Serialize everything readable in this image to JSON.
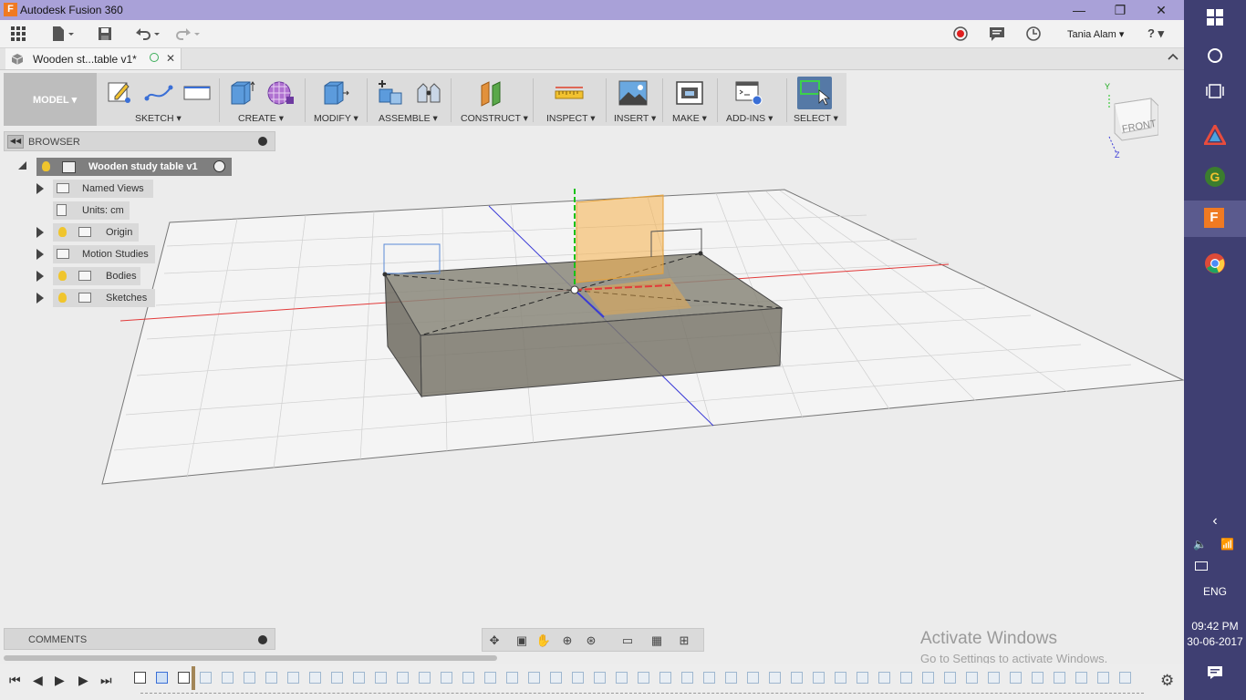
{
  "window": {
    "title": "Autodesk Fusion 360",
    "app_icon_letter": "F",
    "minimize": "—",
    "maximize": "❐",
    "close": "✕"
  },
  "quickbar": {
    "user_name": "Tania Alam ▾",
    "help": "? ▾"
  },
  "document_tab": {
    "label": "Wooden st...table v1*",
    "close": "✕"
  },
  "workspace": {
    "label": "MODEL ▾"
  },
  "ribbon": {
    "groups": [
      {
        "label": "SKETCH ▾"
      },
      {
        "label": "CREATE ▾"
      },
      {
        "label": "MODIFY ▾"
      },
      {
        "label": "ASSEMBLE ▾"
      },
      {
        "label": "CONSTRUCT ▾"
      },
      {
        "label": "INSPECT ▾"
      },
      {
        "label": "INSERT ▾"
      },
      {
        "label": "MAKE ▾"
      },
      {
        "label": "ADD-INS ▾"
      },
      {
        "label": "SELECT ▾"
      }
    ]
  },
  "browser": {
    "title": "BROWSER",
    "root": "Wooden study table v1",
    "items": [
      {
        "label": "Named Views"
      },
      {
        "label": "Units: cm"
      },
      {
        "label": "Origin"
      },
      {
        "label": "Motion Studies"
      },
      {
        "label": "Bodies"
      },
      {
        "label": "Sketches"
      }
    ]
  },
  "comments": {
    "title": "COMMENTS"
  },
  "viewcube": {
    "face": "FRONT",
    "axis_y": "Y",
    "axis_z": "Z"
  },
  "watermark": {
    "line1": "Activate Windows",
    "line2": "Go to Settings to activate Windows."
  },
  "taskbar": {
    "language": "ENG",
    "time": "09:42 PM",
    "date": "30-06-2017"
  },
  "colors": {
    "titlebar": "#a9a1d8",
    "taskbar": "#3f3f72",
    "body_fill": "#8a877a",
    "construction_plane": "#f5b04a",
    "x_axis": "#e23a3a",
    "y_axis": "#19c219",
    "z_axis": "#3a3ad6"
  }
}
